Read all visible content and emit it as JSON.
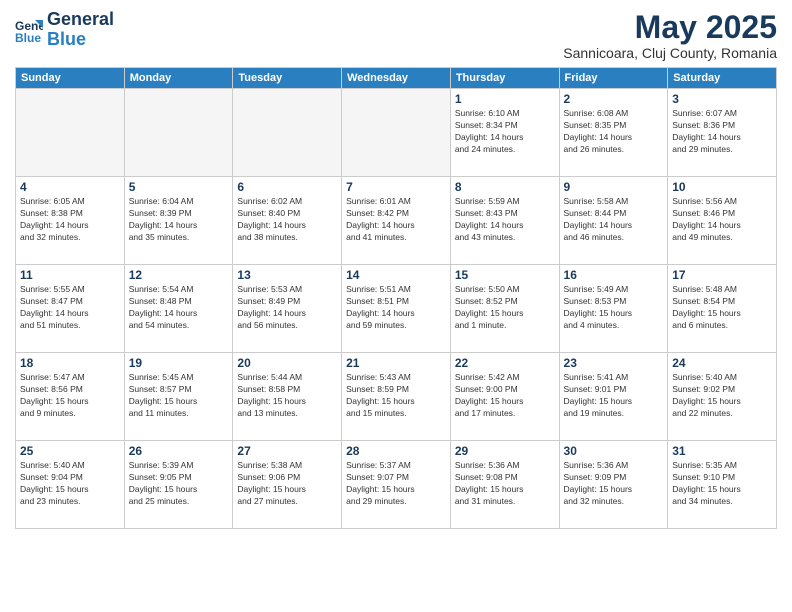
{
  "logo": {
    "line1": "General",
    "line2": "Blue"
  },
  "title": "May 2025",
  "subtitle": "Sannicoara, Cluj County, Romania",
  "weekdays": [
    "Sunday",
    "Monday",
    "Tuesday",
    "Wednesday",
    "Thursday",
    "Friday",
    "Saturday"
  ],
  "weeks": [
    [
      {
        "num": "",
        "info": ""
      },
      {
        "num": "",
        "info": ""
      },
      {
        "num": "",
        "info": ""
      },
      {
        "num": "",
        "info": ""
      },
      {
        "num": "1",
        "info": "Sunrise: 6:10 AM\nSunset: 8:34 PM\nDaylight: 14 hours\nand 24 minutes."
      },
      {
        "num": "2",
        "info": "Sunrise: 6:08 AM\nSunset: 8:35 PM\nDaylight: 14 hours\nand 26 minutes."
      },
      {
        "num": "3",
        "info": "Sunrise: 6:07 AM\nSunset: 8:36 PM\nDaylight: 14 hours\nand 29 minutes."
      }
    ],
    [
      {
        "num": "4",
        "info": "Sunrise: 6:05 AM\nSunset: 8:38 PM\nDaylight: 14 hours\nand 32 minutes."
      },
      {
        "num": "5",
        "info": "Sunrise: 6:04 AM\nSunset: 8:39 PM\nDaylight: 14 hours\nand 35 minutes."
      },
      {
        "num": "6",
        "info": "Sunrise: 6:02 AM\nSunset: 8:40 PM\nDaylight: 14 hours\nand 38 minutes."
      },
      {
        "num": "7",
        "info": "Sunrise: 6:01 AM\nSunset: 8:42 PM\nDaylight: 14 hours\nand 41 minutes."
      },
      {
        "num": "8",
        "info": "Sunrise: 5:59 AM\nSunset: 8:43 PM\nDaylight: 14 hours\nand 43 minutes."
      },
      {
        "num": "9",
        "info": "Sunrise: 5:58 AM\nSunset: 8:44 PM\nDaylight: 14 hours\nand 46 minutes."
      },
      {
        "num": "10",
        "info": "Sunrise: 5:56 AM\nSunset: 8:46 PM\nDaylight: 14 hours\nand 49 minutes."
      }
    ],
    [
      {
        "num": "11",
        "info": "Sunrise: 5:55 AM\nSunset: 8:47 PM\nDaylight: 14 hours\nand 51 minutes."
      },
      {
        "num": "12",
        "info": "Sunrise: 5:54 AM\nSunset: 8:48 PM\nDaylight: 14 hours\nand 54 minutes."
      },
      {
        "num": "13",
        "info": "Sunrise: 5:53 AM\nSunset: 8:49 PM\nDaylight: 14 hours\nand 56 minutes."
      },
      {
        "num": "14",
        "info": "Sunrise: 5:51 AM\nSunset: 8:51 PM\nDaylight: 14 hours\nand 59 minutes."
      },
      {
        "num": "15",
        "info": "Sunrise: 5:50 AM\nSunset: 8:52 PM\nDaylight: 15 hours\nand 1 minute."
      },
      {
        "num": "16",
        "info": "Sunrise: 5:49 AM\nSunset: 8:53 PM\nDaylight: 15 hours\nand 4 minutes."
      },
      {
        "num": "17",
        "info": "Sunrise: 5:48 AM\nSunset: 8:54 PM\nDaylight: 15 hours\nand 6 minutes."
      }
    ],
    [
      {
        "num": "18",
        "info": "Sunrise: 5:47 AM\nSunset: 8:56 PM\nDaylight: 15 hours\nand 9 minutes."
      },
      {
        "num": "19",
        "info": "Sunrise: 5:45 AM\nSunset: 8:57 PM\nDaylight: 15 hours\nand 11 minutes."
      },
      {
        "num": "20",
        "info": "Sunrise: 5:44 AM\nSunset: 8:58 PM\nDaylight: 15 hours\nand 13 minutes."
      },
      {
        "num": "21",
        "info": "Sunrise: 5:43 AM\nSunset: 8:59 PM\nDaylight: 15 hours\nand 15 minutes."
      },
      {
        "num": "22",
        "info": "Sunrise: 5:42 AM\nSunset: 9:00 PM\nDaylight: 15 hours\nand 17 minutes."
      },
      {
        "num": "23",
        "info": "Sunrise: 5:41 AM\nSunset: 9:01 PM\nDaylight: 15 hours\nand 19 minutes."
      },
      {
        "num": "24",
        "info": "Sunrise: 5:40 AM\nSunset: 9:02 PM\nDaylight: 15 hours\nand 22 minutes."
      }
    ],
    [
      {
        "num": "25",
        "info": "Sunrise: 5:40 AM\nSunset: 9:04 PM\nDaylight: 15 hours\nand 23 minutes."
      },
      {
        "num": "26",
        "info": "Sunrise: 5:39 AM\nSunset: 9:05 PM\nDaylight: 15 hours\nand 25 minutes."
      },
      {
        "num": "27",
        "info": "Sunrise: 5:38 AM\nSunset: 9:06 PM\nDaylight: 15 hours\nand 27 minutes."
      },
      {
        "num": "28",
        "info": "Sunrise: 5:37 AM\nSunset: 9:07 PM\nDaylight: 15 hours\nand 29 minutes."
      },
      {
        "num": "29",
        "info": "Sunrise: 5:36 AM\nSunset: 9:08 PM\nDaylight: 15 hours\nand 31 minutes."
      },
      {
        "num": "30",
        "info": "Sunrise: 5:36 AM\nSunset: 9:09 PM\nDaylight: 15 hours\nand 32 minutes."
      },
      {
        "num": "31",
        "info": "Sunrise: 5:35 AM\nSunset: 9:10 PM\nDaylight: 15 hours\nand 34 minutes."
      }
    ]
  ]
}
